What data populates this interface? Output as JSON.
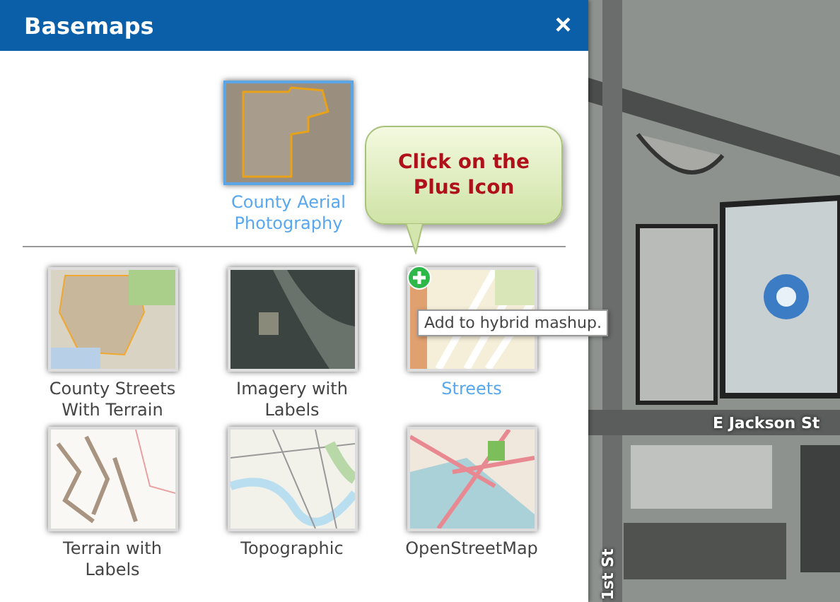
{
  "panel": {
    "title": "Basemaps",
    "close": "×"
  },
  "featured": {
    "label": "County Aerial Photography",
    "selected": true
  },
  "basemaps": [
    {
      "label": "County Streets With Terrain",
      "kind": "county",
      "selected": false
    },
    {
      "label": "Imagery with Labels",
      "kind": "imagery",
      "selected": false
    },
    {
      "label": "Streets",
      "kind": "streets",
      "selected": true
    },
    {
      "label": "Terrain with Labels",
      "kind": "terrain",
      "selected": false
    },
    {
      "label": "Topographic",
      "kind": "topo",
      "selected": false
    },
    {
      "label": "OpenStreetMap",
      "kind": "osm",
      "selected": false
    }
  ],
  "callout": {
    "text": "Click on the Plus Icon"
  },
  "tooltip": {
    "text": "Add to hybrid mashup."
  },
  "map": {
    "labels": [
      {
        "text": "E Jackson St",
        "kind": "horizontal"
      },
      {
        "text": "1st St",
        "kind": "vertical"
      }
    ]
  }
}
